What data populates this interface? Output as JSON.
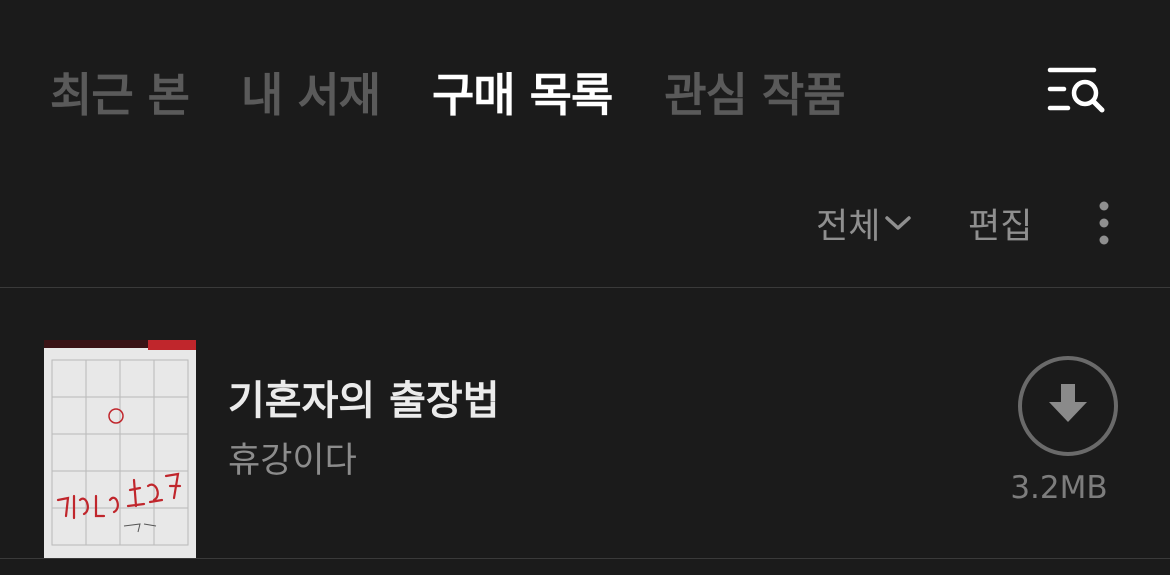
{
  "tabs": [
    {
      "label": "최근 본",
      "active": false
    },
    {
      "label": "내 서재",
      "active": false
    },
    {
      "label": "구매 목록",
      "active": true
    },
    {
      "label": "관심 작품",
      "active": false
    }
  ],
  "header": {
    "search_menu_icon": "list-search-icon"
  },
  "filter": {
    "selected": "전체",
    "dropdown_icon": "chevron-down-icon",
    "edit_label": "편집",
    "more_icon": "vertical-dots-icon"
  },
  "books": [
    {
      "title": "기혼자의 출장법",
      "author": "휴강이다",
      "file_size": "3.2MB",
      "download_icon": "download-arrow-icon"
    }
  ],
  "colors": {
    "background": "#1b1b1b",
    "tab_active": "#ffffff",
    "tab_inactive": "#5a5a5a",
    "secondary_text": "#8f8f8f",
    "cover_accent": "#c0262c"
  }
}
